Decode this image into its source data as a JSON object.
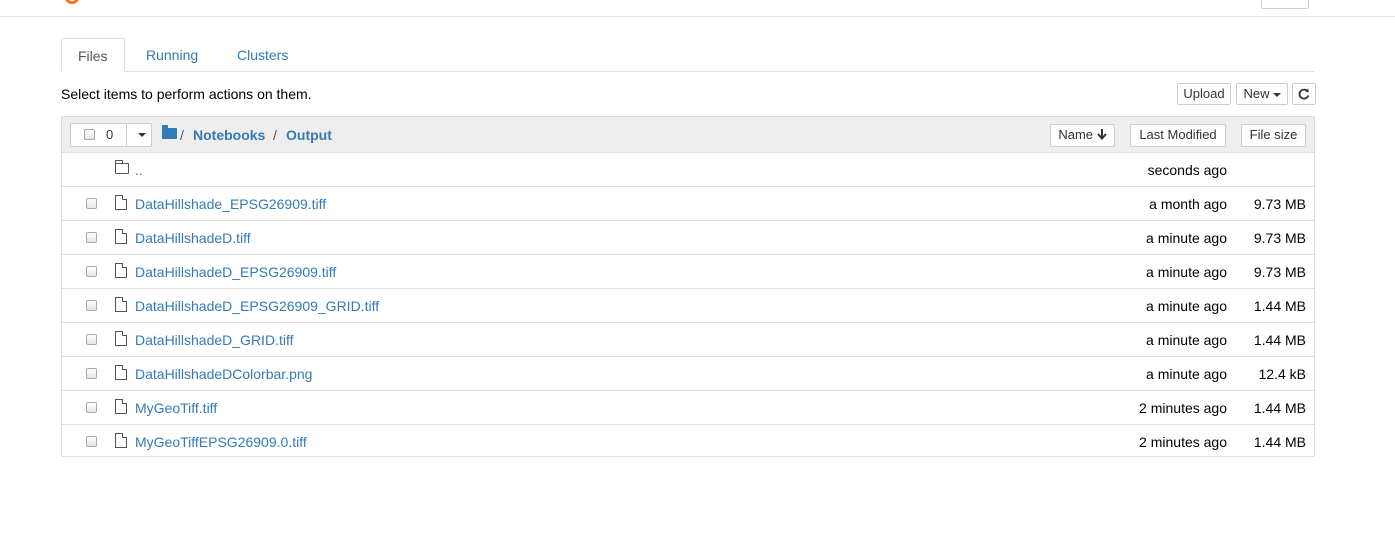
{
  "tabs": [
    {
      "label": "Files"
    },
    {
      "label": "Running"
    },
    {
      "label": "Clusters"
    }
  ],
  "hint": "Select items to perform actions on them.",
  "toolbar": {
    "upload_label": "Upload",
    "new_label": "New",
    "refresh_icon": "refresh-icon"
  },
  "list_header": {
    "selected_count": "0",
    "breadcrumb": [
      {
        "sep": "/",
        "label": "Notebooks"
      },
      {
        "sep": "/",
        "label": "Output"
      }
    ],
    "sort_name_label": "Name",
    "last_modified_label": "Last Modified",
    "file_size_label": "File size"
  },
  "parent_row": {
    "name": "..",
    "modified": "seconds ago"
  },
  "files": [
    {
      "name": "DataHillshade_EPSG26909.tiff",
      "modified": "a month ago",
      "size": "9.73 MB"
    },
    {
      "name": "DataHillshadeD.tiff",
      "modified": "a minute ago",
      "size": "9.73 MB"
    },
    {
      "name": "DataHillshadeD_EPSG26909.tiff",
      "modified": "a minute ago",
      "size": "9.73 MB"
    },
    {
      "name": "DataHillshadeD_EPSG26909_GRID.tiff",
      "modified": "a minute ago",
      "size": "1.44 MB"
    },
    {
      "name": "DataHillshadeD_GRID.tiff",
      "modified": "a minute ago",
      "size": "1.44 MB"
    },
    {
      "name": "DataHillshadeDColorbar.png",
      "modified": "a minute ago",
      "size": "12.4 kB"
    },
    {
      "name": "MyGeoTiff.tiff",
      "modified": "2 minutes ago",
      "size": "1.44 MB"
    },
    {
      "name": "MyGeoTiffEPSG26909.0.tiff",
      "modified": "2 minutes ago",
      "size": "1.44 MB"
    }
  ],
  "colors": {
    "link": "#337ab7",
    "accent": "#f37726",
    "header_bg": "#eeeeee"
  }
}
